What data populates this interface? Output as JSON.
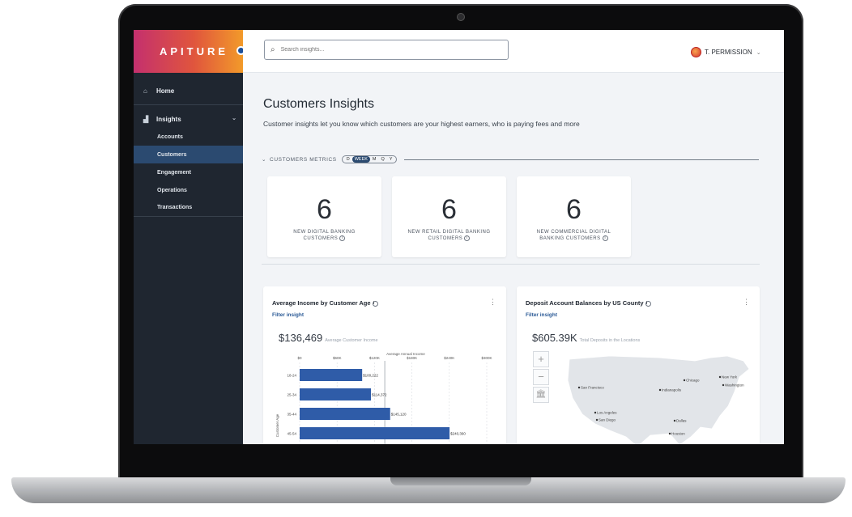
{
  "brand": {
    "name": "APITURE"
  },
  "sidebar": {
    "home_label": "Home",
    "insights_label": "Insights",
    "sub_items": [
      "Accounts",
      "Customers",
      "Engagement",
      "Operations",
      "Transactions"
    ],
    "active_index": 1
  },
  "topbar": {
    "search_placeholder": "Search insights...",
    "user_name": "T. PERMISSION"
  },
  "page": {
    "title": "Customers Insights",
    "subtitle": "Customer insights let you know which customers are your highest earners, who is paying fees and more"
  },
  "metrics": {
    "label": "CUSTOMERS METRICS",
    "periods": [
      "D",
      "WEEK",
      "M",
      "Q",
      "Y"
    ],
    "active_period": 1,
    "kpis": [
      {
        "value": "6",
        "label": "NEW DIGITAL BANKING CUSTOMERS"
      },
      {
        "value": "6",
        "label": "NEW RETAIL DIGITAL BANKING CUSTOMERS"
      },
      {
        "value": "6",
        "label": "NEW COMMERCIAL DIGITAL BANKING CUSTOMERS"
      }
    ]
  },
  "cards": {
    "income": {
      "title": "Average Income by Customer Age",
      "filter": "Filter insight",
      "stat": "$136,469",
      "stat_sub": "Average Customer Income"
    },
    "deposit": {
      "title": "Deposit Account Balances by US County",
      "filter": "Filter insight",
      "stat": "$605.39K",
      "stat_sub": "Total Deposits in the Locations",
      "cities": [
        "San Francisco",
        "Los Angeles",
        "San Diego",
        "Chicago",
        "Indianapolis",
        "New York",
        "Washington",
        "Dallas",
        "Houston"
      ]
    }
  },
  "chart_data": {
    "type": "bar",
    "orientation": "horizontal",
    "categories": [
      "18-24",
      "25-34",
      "35-44",
      "45-54"
    ],
    "values": [
      100222,
      114372,
      145120,
      240360
    ],
    "data_labels": [
      "$100,222",
      "$114,372",
      "$145,120",
      "$240,360"
    ],
    "xlabel": "",
    "ylabel": "Customer Age",
    "x_ticks": [
      "$0",
      "$60K",
      "$120K",
      "$180K",
      "$240K",
      "$300K"
    ],
    "xlim": [
      0,
      300000
    ],
    "reference_line": {
      "label": "Average Annual Income",
      "value": 136469
    },
    "bar_color": "#2f5ca8"
  }
}
